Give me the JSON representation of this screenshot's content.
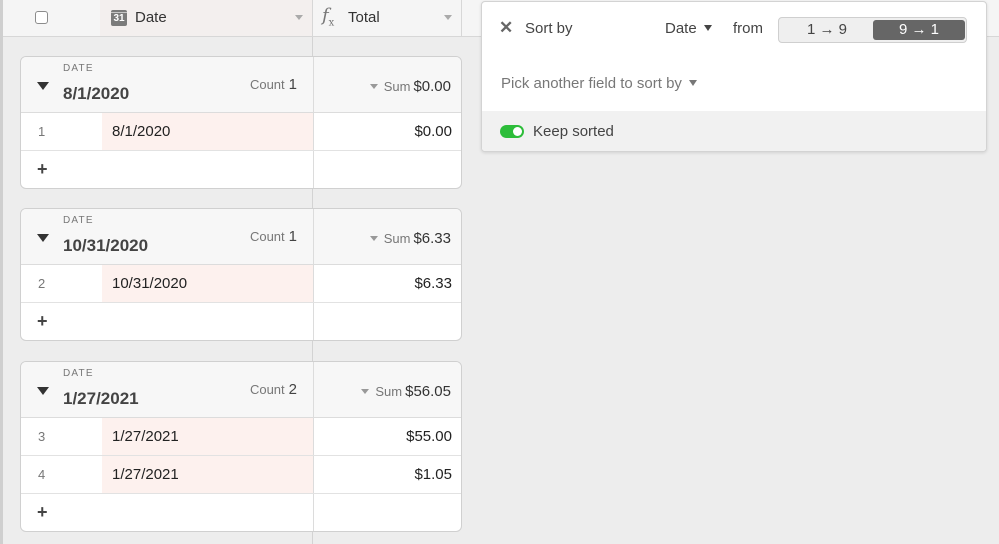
{
  "header": {
    "columns": [
      {
        "name": "Date",
        "icon": "calendar-icon",
        "icon_text": "31"
      },
      {
        "name": "Total",
        "icon": "formula-icon",
        "icon_text": "f",
        "icon_sub": "x"
      }
    ]
  },
  "groups": [
    {
      "field_label": "DATE",
      "value": "8/1/2020",
      "count_label": "Count",
      "count": "1",
      "sum_label": "Sum",
      "sum": "$0.00",
      "rows": [
        {
          "num": "1",
          "date": "8/1/2020",
          "total": "$0.00"
        }
      ]
    },
    {
      "field_label": "DATE",
      "value": "10/31/2020",
      "count_label": "Count",
      "count": "1",
      "sum_label": "Sum",
      "sum": "$6.33",
      "rows": [
        {
          "num": "2",
          "date": "10/31/2020",
          "total": "$6.33"
        }
      ]
    },
    {
      "field_label": "DATE",
      "value": "1/27/2021",
      "count_label": "Count",
      "count": "2",
      "sum_label": "Sum",
      "sum": "$56.05",
      "rows": [
        {
          "num": "3",
          "date": "1/27/2021",
          "total": "$55.00"
        },
        {
          "num": "4",
          "date": "1/27/2021",
          "total": "$1.05"
        }
      ]
    }
  ],
  "add_row_symbol": "+",
  "sort_panel": {
    "close_symbol": "✕",
    "title": "Sort by",
    "field": "Date",
    "from_label": "from",
    "direction_options": [
      "1 → 9",
      "9 → 1"
    ],
    "selected_direction": "9 → 1",
    "pick_another": "Pick another field to sort by",
    "keep_sorted_label": "Keep sorted",
    "keep_sorted": true,
    "toggle_color": "#2dbd3a"
  }
}
